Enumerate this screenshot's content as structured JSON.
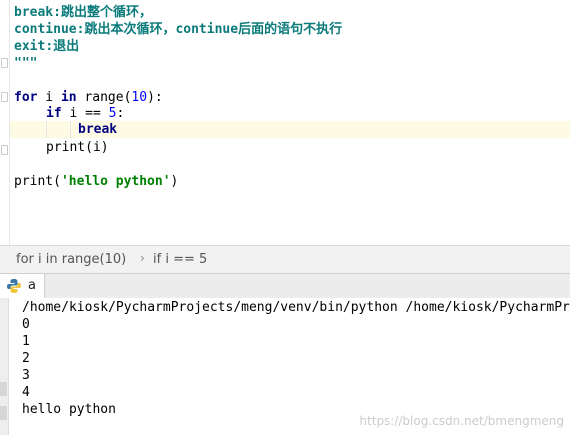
{
  "editor": {
    "lines": {
      "l1a": "break",
      "l1b": ":跳出整个循环，",
      "l2a": "continue",
      "l2b": ":跳出本次循环，",
      "l2c": "continue",
      "l2d": "后面的语句不执行",
      "l3a": "exit",
      "l3b": ":退出",
      "l4": "\"\"\"",
      "l6_for": "for",
      "l6_i": " i ",
      "l6_in": "in",
      "l6_range": " range(",
      "l6_num": "10",
      "l6_end": "):",
      "l7_if": "if",
      "l7_rest": " i == ",
      "l7_num": "5",
      "l7_end": ":",
      "l8_break": "break",
      "l9": "print(i)",
      "l11_a": "print(",
      "l11_str": "'hello python'",
      "l11_b": ")"
    }
  },
  "breadcrumb": {
    "item1": "for i in range(10)",
    "separator": "›",
    "item2": "if i == 5"
  },
  "run_panel": {
    "tab_label": "a",
    "tab_icon": "python-icon",
    "output": [
      "/home/kiosk/PycharmProjects/meng/venv/bin/python /home/kiosk/PycharmProjects",
      "0",
      "1",
      "2",
      "3",
      "4",
      "hello python"
    ]
  },
  "watermark": "https://blog.csdn.net/bmengmeng"
}
